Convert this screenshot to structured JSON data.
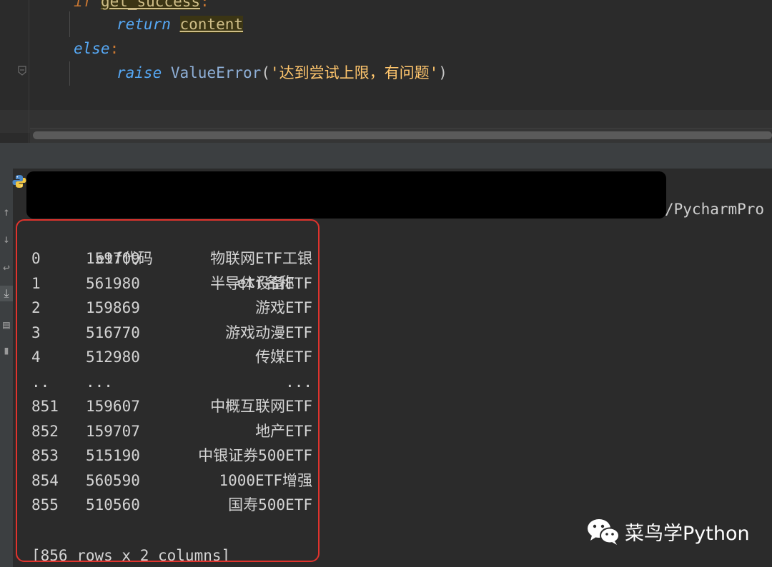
{
  "editor": {
    "line1": {
      "keyword": "if",
      "identifier": "get_success",
      "punct": ":"
    },
    "line2": {
      "keyword": "return",
      "identifier": "content"
    },
    "line3": {
      "keyword": "else",
      "punct": ":"
    },
    "line4": {
      "keyword": "raise",
      "builtin": "ValueError",
      "open": "(",
      "string": "'达到尝试上限，有问题'",
      "close": ")"
    }
  },
  "console": {
    "path_fragment": "/PycharmPro",
    "dataframe": {
      "columns": [
        "etf代码",
        "etf名称"
      ],
      "rows": [
        {
          "index": "0",
          "code": "159709",
          "name": "物联网ETF工银"
        },
        {
          "index": "1",
          "code": "561980",
          "name": "半导体设备ETF"
        },
        {
          "index": "2",
          "code": "159869",
          "name": "游戏ETF"
        },
        {
          "index": "3",
          "code": "516770",
          "name": "游戏动漫ETF"
        },
        {
          "index": "4",
          "code": "512980",
          "name": "传媒ETF"
        },
        {
          "index": "..",
          "code": "...",
          "name": "..."
        },
        {
          "index": "851",
          "code": "159607",
          "name": "中概互联网ETF"
        },
        {
          "index": "852",
          "code": "159707",
          "name": "地产ETF"
        },
        {
          "index": "853",
          "code": "515190",
          "name": "中银证券500ETF"
        },
        {
          "index": "854",
          "code": "560590",
          "name": "1000ETF增强"
        },
        {
          "index": "855",
          "code": "510560",
          "name": "国寿500ETF"
        }
      ],
      "summary": "[856 rows x 2 columns]"
    },
    "toolbar_icons": [
      "up-arrow-icon",
      "down-arrow-icon",
      "soft-wrap-icon",
      "scroll-to-end-icon",
      "print-icon",
      "trash-icon"
    ]
  },
  "watermark": {
    "text": "菜鸟学Python",
    "icon": "wechat-icon"
  },
  "colors": {
    "background": "#2b2b2b",
    "keyword": "#cc7832",
    "string": "#ffc66d",
    "highlight": "#3b3514",
    "output_border": "#e0332d"
  }
}
